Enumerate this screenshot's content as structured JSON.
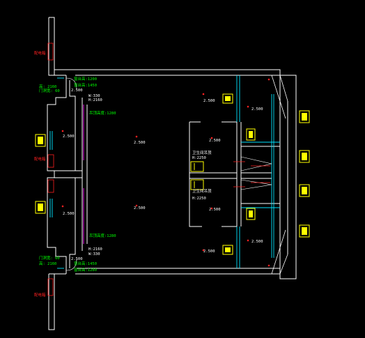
{
  "colors": {
    "background": "#000000",
    "wall": "#ffffff",
    "label_green": "#00ff00",
    "label_red": "#ff2020",
    "symbol_yellow": "#ffff00",
    "glass_cyan": "#00e5ff",
    "magenta": "#ff00ff"
  },
  "green_labels": {
    "sill_top": "窗台高:1200",
    "sill_top2": "窗台高:1450",
    "ceiling_left_top": "吊顶高度:1280",
    "ceiling_left_bottom": "吊顶高度:1280",
    "sill_bottom": "窗台高:1450",
    "sill_bottom2": "窗台高:1280",
    "door_top_h": "高: 2160",
    "door_top_w": "门洞宽: 60",
    "door_bottom_w": "门洞宽: 60",
    "door_bottom_h": "高: 2160"
  },
  "white_labels": {
    "w330_top": "W:330",
    "h2160_top": "H:2160",
    "h2160_bottom": "H:2160",
    "w330_bottom": "W:330",
    "bath_top_title": "卫生间吊顶",
    "bath_top_h": "H:2250",
    "bath_bottom_title": "卫生间吊顶",
    "bath_bottom_h": "H:2250"
  },
  "elevations": {
    "left_top_window": "2.500",
    "left_top_room": "2.500",
    "left_bottom_window": "2.500",
    "left_bottom_room": "2.500",
    "center_top": "2.500",
    "center_bottom": "2.500",
    "right_top_ac": "2.500",
    "right_top_corner": "2.500",
    "bath_top_lower": "2.500",
    "bath_bottom_lower": "2.500",
    "right_bottom_corner": "2.500",
    "right_bottom_ac": "2.500"
  },
  "red_labels": {
    "left_side_top": "配电箱",
    "left_side_bottom": "配电箱",
    "mid_left": "配电箱"
  },
  "icons": [
    "ceiling-light-icon",
    "exhaust-fan-icon",
    "air-conditioner-icon",
    "smoke-detector-icon"
  ]
}
